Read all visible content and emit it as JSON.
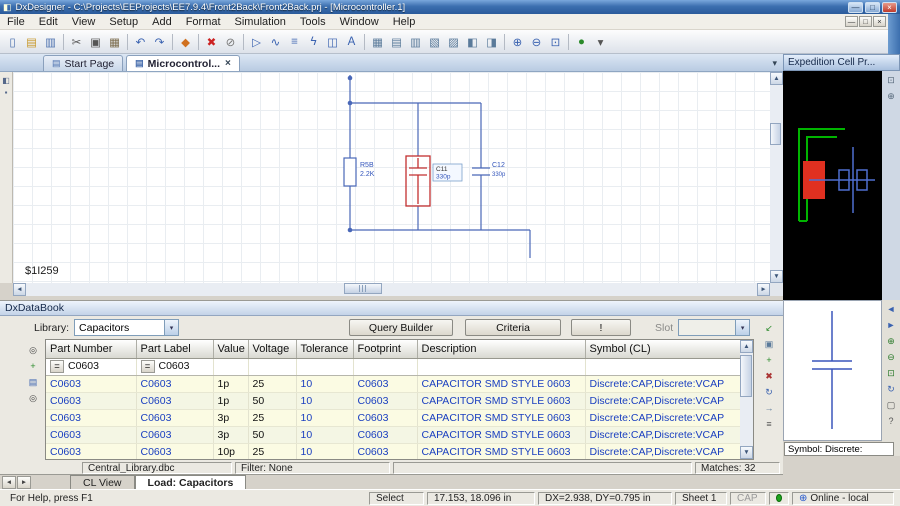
{
  "titlebar": {
    "title": "DxDesigner - C:\\Projects\\EEProjects\\EE7.9.4\\Front2Back\\Front2Back.prj - [Microcontroller.1]",
    "window_controls": [
      {
        "name": "minimize-button",
        "glyph": "—"
      },
      {
        "name": "restore-button",
        "glyph": "□"
      },
      {
        "name": "close-button",
        "glyph": "×"
      }
    ]
  },
  "menubar": {
    "items": [
      "File",
      "Edit",
      "View",
      "Setup",
      "Add",
      "Format",
      "Simulation",
      "Tools",
      "Window",
      "Help"
    ],
    "mdi_controls": [
      {
        "name": "mdi-minimize-button",
        "glyph": "—"
      },
      {
        "name": "mdi-restore-button",
        "glyph": "□"
      },
      {
        "name": "mdi-close-button",
        "glyph": "×"
      }
    ]
  },
  "toolbar": {
    "icons": [
      {
        "name": "new-icon",
        "glyph": "▯",
        "color": "#4a6fae"
      },
      {
        "name": "open-icon",
        "glyph": "▤",
        "color": "#c8982a"
      },
      {
        "name": "save-icon",
        "glyph": "▥",
        "color": "#4a6fae"
      },
      {
        "name": "separator"
      },
      {
        "name": "cut-icon",
        "glyph": "✂",
        "color": "#555555"
      },
      {
        "name": "copy-icon",
        "glyph": "▣",
        "color": "#555555"
      },
      {
        "name": "paste-icon",
        "glyph": "▦",
        "color": "#7a6a4a"
      },
      {
        "name": "separator"
      },
      {
        "name": "undo-icon",
        "glyph": "↶",
        "color": "#3a62b0"
      },
      {
        "name": "redo-icon",
        "glyph": "↷",
        "color": "#3a62b0"
      },
      {
        "name": "separator"
      },
      {
        "name": "color-picker-icon",
        "glyph": "◆",
        "color": "#d07020"
      },
      {
        "name": "separator"
      },
      {
        "name": "delete-icon",
        "glyph": "✖",
        "color": "#cc2222"
      },
      {
        "name": "no-connect-icon",
        "glyph": "⊘",
        "color": "#777777"
      },
      {
        "name": "separator"
      },
      {
        "name": "select-mode-icon",
        "glyph": "▷",
        "color": "#3a62b0"
      },
      {
        "name": "add-wire-icon",
        "glyph": "∿",
        "color": "#3a62b0"
      },
      {
        "name": "add-bus-icon",
        "glyph": "≡",
        "color": "#3a62b0"
      },
      {
        "name": "add-net-icon",
        "glyph": "ϟ",
        "color": "#3a62b0"
      },
      {
        "name": "add-part-icon",
        "glyph": "◫",
        "color": "#3a62b0"
      },
      {
        "name": "add-text-icon",
        "glyph": "A",
        "color": "#3a62b0"
      },
      {
        "name": "separator"
      },
      {
        "name": "grid-icon",
        "glyph": "▦",
        "color": "#5a7a9a"
      },
      {
        "name": "align-left-icon",
        "glyph": "▤",
        "color": "#5a7a9a"
      },
      {
        "name": "align-top-icon",
        "glyph": "▥",
        "color": "#5a7a9a"
      },
      {
        "name": "distribute-h-icon",
        "glyph": "▧",
        "color": "#5a7a9a"
      },
      {
        "name": "distribute-v-icon",
        "glyph": "▨",
        "color": "#5a7a9a"
      },
      {
        "name": "mirror-icon",
        "glyph": "◧",
        "color": "#5a7a9a"
      },
      {
        "name": "rotate-icon",
        "glyph": "◨",
        "color": "#5a7a9a"
      },
      {
        "name": "separator"
      },
      {
        "name": "zoom-in-icon",
        "glyph": "⊕",
        "color": "#3a62b0"
      },
      {
        "name": "zoom-out-icon",
        "glyph": "⊖",
        "color": "#3a62b0"
      },
      {
        "name": "zoom-fit-icon",
        "glyph": "⊡",
        "color": "#3a62b0"
      },
      {
        "name": "separator"
      },
      {
        "name": "online-drc-icon",
        "glyph": "●",
        "color": "#2a8a2a"
      },
      {
        "name": "toolbar-options-icon",
        "glyph": "▾",
        "color": "#555555"
      }
    ]
  },
  "doc_tabs": {
    "tabs": [
      {
        "label": "Start Page",
        "active": false,
        "closable": false
      },
      {
        "label": "Microcontrol...",
        "active": true,
        "closable": true
      }
    ]
  },
  "navigator": {
    "tools": [
      {
        "name": "navigator-tab-icon",
        "glyph": "◧",
        "color": "#55688a"
      },
      {
        "name": "pin-icon",
        "glyph": "▪",
        "color": "#55688a"
      }
    ]
  },
  "schematic": {
    "net_label": "$1I259",
    "components": {
      "r5b": {
        "ref": "R5B",
        "value": "2.2K"
      },
      "c11": {
        "ref": "C11",
        "value": "330p"
      },
      "c12": {
        "ref": "C12",
        "value": "330p"
      }
    }
  },
  "cell_panel": {
    "title": "Expedition Cell Pr...",
    "symbol_caption": "Symbol: Discrete:",
    "tools": [
      {
        "name": "cell-fit-icon",
        "glyph": "⊡",
        "color": "#56687a"
      },
      {
        "name": "cell-zoom-icon",
        "glyph": "⊕",
        "color": "#56687a"
      }
    ],
    "symbol_tools": [
      {
        "name": "symbol-prev-icon",
        "glyph": "◄",
        "color": "#3a62b0"
      },
      {
        "name": "symbol-next-icon",
        "glyph": "►",
        "color": "#3a62b0"
      },
      {
        "name": "symbol-zoom-in-icon",
        "glyph": "⊕",
        "color": "#2a7a2a"
      },
      {
        "name": "symbol-zoom-out-icon",
        "glyph": "⊖",
        "color": "#2a7a2a"
      },
      {
        "name": "symbol-fit-icon",
        "glyph": "⊡",
        "color": "#2a7a2a"
      },
      {
        "name": "symbol-rotate-icon",
        "glyph": "↻",
        "color": "#3a62b0"
      },
      {
        "name": "symbol-select-icon",
        "glyph": "▢",
        "color": "#555555"
      },
      {
        "name": "symbol-help-icon",
        "glyph": "?",
        "color": "#555555"
      }
    ]
  },
  "databook": {
    "title": "DxDataBook",
    "library_label": "Library:",
    "library_value": "Capacitors",
    "query_builder_label": "Query Builder",
    "criteria_label": "Criteria",
    "exclaim_label": "!",
    "slot_label": "Slot",
    "columns": [
      "Part Number",
      "Part Label",
      "Value",
      "Voltage",
      "Tolerance",
      "Footprint",
      "Description",
      "Symbol (CL)"
    ],
    "filter_operator": "=",
    "filter_values": [
      "C0603",
      "C0603",
      "",
      "",
      "",
      "",
      "",
      ""
    ],
    "rows": [
      [
        "C0603",
        "C0603",
        "1p",
        "25",
        "10",
        "C0603",
        "CAPACITOR SMD STYLE 0603",
        "Discrete:CAP,Discrete:VCAP"
      ],
      [
        "C0603",
        "C0603",
        "1p",
        "50",
        "10",
        "C0603",
        "CAPACITOR SMD STYLE 0603",
        "Discrete:CAP,Discrete:VCAP"
      ],
      [
        "C0603",
        "C0603",
        "3p",
        "25",
        "10",
        "C0603",
        "CAPACITOR SMD STYLE 0603",
        "Discrete:CAP,Discrete:VCAP"
      ],
      [
        "C0603",
        "C0603",
        "3p",
        "50",
        "10",
        "C0603",
        "CAPACITOR SMD STYLE 0603",
        "Discrete:CAP,Discrete:VCAP"
      ],
      [
        "C0603",
        "C0603",
        "10p",
        "25",
        "10",
        "C0603",
        "CAPACITOR SMD STYLE 0603",
        "Discrete:CAP,Discrete:VCAP"
      ]
    ],
    "left_tools": [
      {
        "name": "find-part-icon",
        "glyph": "◎",
        "color": "#444444"
      },
      {
        "name": "place-symbol-icon",
        "glyph": "+",
        "color": "#2a8a2a"
      },
      {
        "name": "view-mode-icon",
        "glyph": "▤",
        "color": "#3a62b0"
      },
      {
        "name": "find-again-icon",
        "glyph": "◎",
        "color": "#444444"
      }
    ],
    "right_tools": [
      {
        "name": "apply-part-icon",
        "glyph": "↙",
        "color": "#2a8a2a"
      },
      {
        "name": "copy-properties-icon",
        "glyph": "▣",
        "color": "#5a7a9a"
      },
      {
        "name": "new-query-icon",
        "glyph": "+",
        "color": "#2a8a2a"
      },
      {
        "name": "clear-query-icon",
        "glyph": "✖",
        "color": "#aa3333"
      },
      {
        "name": "refresh-icon",
        "glyph": "↻",
        "color": "#3a62b0"
      },
      {
        "name": "export-icon",
        "glyph": "→",
        "color": "#5a7a9a"
      },
      {
        "name": "databook-options-icon",
        "glyph": "≡",
        "color": "#555555"
      }
    ],
    "footer": {
      "library_file": "Central_Library.dbc",
      "filter": "Filter: None",
      "matches": "Matches: 32"
    }
  },
  "bottom_tabs": {
    "tabs": [
      {
        "label": "CL View",
        "active": false
      },
      {
        "label": "Load: Capacitors",
        "active": true
      }
    ]
  },
  "statusbar": {
    "help": "For Help, press F1",
    "mode": "Select",
    "coords": "17.153, 18.096 in",
    "delta": "DX=2.938, DY=0.795 in",
    "sheet": "Sheet 1",
    "cap": "CAP",
    "online": "Online - local"
  }
}
